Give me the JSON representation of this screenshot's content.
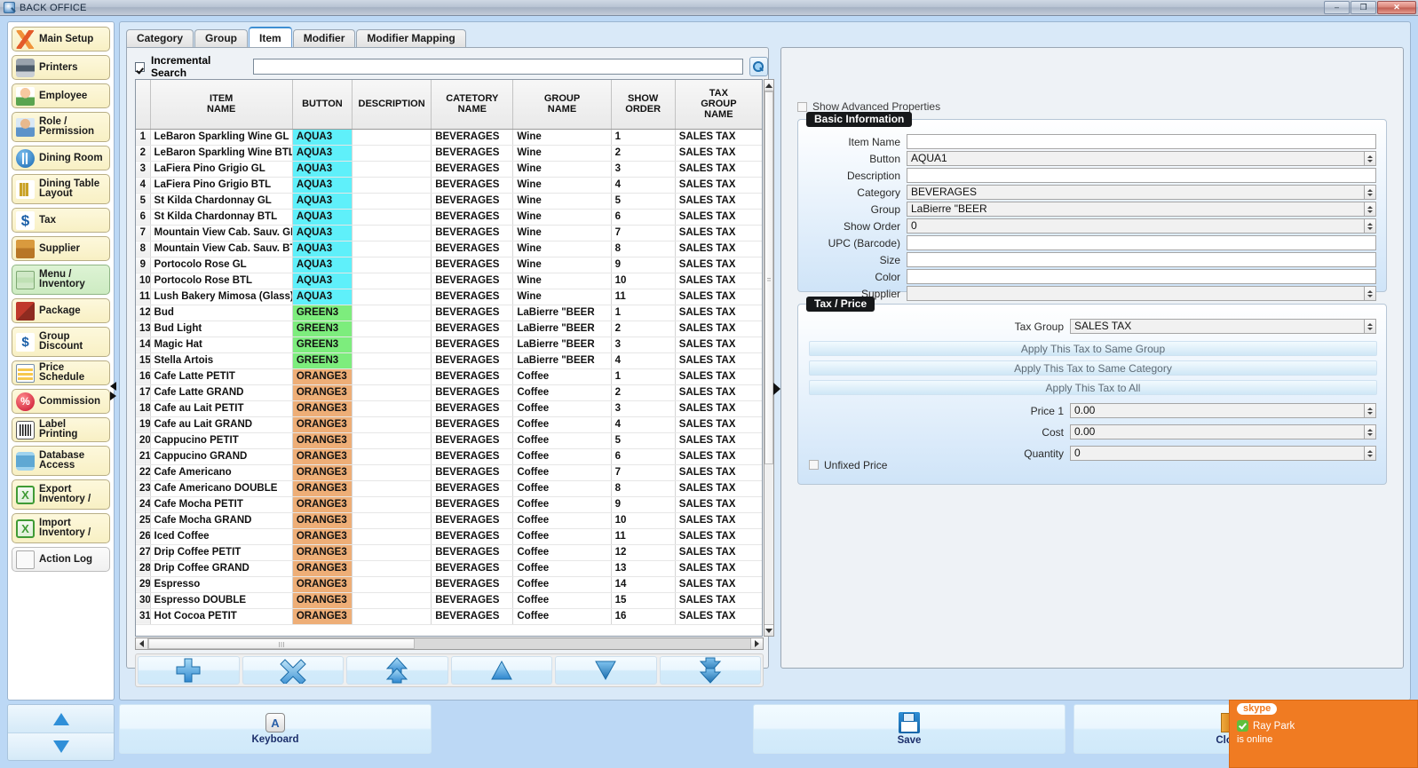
{
  "window": {
    "title": "BACK OFFICE",
    "icon": "app-search-icon",
    "controls": {
      "minimize": "–",
      "restore": "❐",
      "close": "✕"
    }
  },
  "sidebar": {
    "items": [
      {
        "label": "Main Setup",
        "icon": "tools-icon",
        "state": "normal"
      },
      {
        "label": "Printers",
        "icon": "printer-icon",
        "state": "normal"
      },
      {
        "label": "Employee",
        "icon": "employee-icon",
        "state": "normal"
      },
      {
        "label": "Role /\nPermission",
        "icon": "role-icon",
        "state": "normal"
      },
      {
        "label": "Dining Room",
        "icon": "dining-room-icon",
        "state": "normal"
      },
      {
        "label": "Dining Table\nLayout",
        "icon": "table-layout-icon",
        "state": "normal"
      },
      {
        "label": "Tax",
        "icon": "dollar-icon",
        "state": "normal"
      },
      {
        "label": "Supplier",
        "icon": "supplier-icon",
        "state": "normal"
      },
      {
        "label": "Menu /\nInventory",
        "icon": "menu-inventory-icon",
        "state": "active"
      },
      {
        "label": "Package",
        "icon": "package-icon",
        "state": "normal"
      },
      {
        "label": "Group\nDiscount",
        "icon": "group-discount-icon",
        "state": "normal"
      },
      {
        "label": "Price Schedule",
        "icon": "price-schedule-icon",
        "state": "normal"
      },
      {
        "label": "Commission",
        "icon": "percent-icon",
        "state": "normal"
      },
      {
        "label": "Label Printing",
        "icon": "barcode-icon",
        "state": "normal"
      },
      {
        "label": "Database\nAccess",
        "icon": "database-icon",
        "state": "normal"
      },
      {
        "label": "Export\nInventory /",
        "icon": "excel-export-icon",
        "state": "normal"
      },
      {
        "label": "Import\nInventory /",
        "icon": "excel-import-icon",
        "state": "normal"
      },
      {
        "label": "Action Log",
        "icon": "log-icon",
        "state": "plain"
      }
    ],
    "scroll_up": "scroll-up-arrow",
    "scroll_down": "scroll-down-arrow",
    "collapse": "collapse-handle"
  },
  "tabs": [
    {
      "label": "Category",
      "selected": false
    },
    {
      "label": "Group",
      "selected": false
    },
    {
      "label": "Item",
      "selected": true
    },
    {
      "label": "Modifier",
      "selected": false
    },
    {
      "label": "Modifier Mapping",
      "selected": false
    }
  ],
  "search": {
    "checkbox_label": "Incremental Search",
    "checked": true,
    "value": "",
    "placeholder": "",
    "button_icon": "magnifier-icon"
  },
  "table": {
    "columns": [
      "ITEM\nNAME",
      "BUTTON",
      "DESCRIPTION",
      "CATETORY\nNAME",
      "GROUP\nNAME",
      "SHOW\nORDER",
      "TAX\nGROUP\nNAME"
    ],
    "button_colors": {
      "AQUA3": "#5ff0fa",
      "GREEN3": "#7ded7d",
      "ORANGE3": "#eeae77"
    },
    "rows": [
      {
        "n": "1",
        "item": "LeBaron Sparkling Wine GL",
        "button": "AQUA3",
        "desc": "",
        "category": "BEVERAGES",
        "group": "Wine",
        "show": "1",
        "tax": "SALES TAX"
      },
      {
        "n": "2",
        "item": "LeBaron Sparkling Wine BTL",
        "button": "AQUA3",
        "desc": "",
        "category": "BEVERAGES",
        "group": "Wine",
        "show": "2",
        "tax": "SALES TAX"
      },
      {
        "n": "3",
        "item": "LaFiera Pino Grigio GL",
        "button": "AQUA3",
        "desc": "",
        "category": "BEVERAGES",
        "group": "Wine",
        "show": "3",
        "tax": "SALES TAX"
      },
      {
        "n": "4",
        "item": "LaFiera Pino Grigio BTL",
        "button": "AQUA3",
        "desc": "",
        "category": "BEVERAGES",
        "group": "Wine",
        "show": "4",
        "tax": "SALES TAX"
      },
      {
        "n": "5",
        "item": "St Kilda Chardonnay GL",
        "button": "AQUA3",
        "desc": "",
        "category": "BEVERAGES",
        "group": "Wine",
        "show": "5",
        "tax": "SALES TAX"
      },
      {
        "n": "6",
        "item": "St Kilda Chardonnay BTL",
        "button": "AQUA3",
        "desc": "",
        "category": "BEVERAGES",
        "group": "Wine",
        "show": "6",
        "tax": "SALES TAX"
      },
      {
        "n": "7",
        "item": "Mountain View Cab. Sauv. GL",
        "button": "AQUA3",
        "desc": "",
        "category": "BEVERAGES",
        "group": "Wine",
        "show": "7",
        "tax": "SALES TAX"
      },
      {
        "n": "8",
        "item": "Mountain View Cab. Sauv. BTL",
        "button": "AQUA3",
        "desc": "",
        "category": "BEVERAGES",
        "group": "Wine",
        "show": "8",
        "tax": "SALES TAX"
      },
      {
        "n": "9",
        "item": "Portocolo Rose GL",
        "button": "AQUA3",
        "desc": "",
        "category": "BEVERAGES",
        "group": "Wine",
        "show": "9",
        "tax": "SALES TAX"
      },
      {
        "n": "10",
        "item": "Portocolo Rose BTL",
        "button": "AQUA3",
        "desc": "",
        "category": "BEVERAGES",
        "group": "Wine",
        "show": "10",
        "tax": "SALES TAX"
      },
      {
        "n": "11",
        "item": "Lush Bakery Mimosa (Glass)",
        "button": "AQUA3",
        "desc": "",
        "category": "BEVERAGES",
        "group": "Wine",
        "show": "11",
        "tax": "SALES TAX"
      },
      {
        "n": "12",
        "item": "Bud",
        "button": "GREEN3",
        "desc": "",
        "category": "BEVERAGES",
        "group": "LaBierre \"BEER",
        "show": "1",
        "tax": "SALES TAX"
      },
      {
        "n": "13",
        "item": "Bud Light",
        "button": "GREEN3",
        "desc": "",
        "category": "BEVERAGES",
        "group": "LaBierre \"BEER",
        "show": "2",
        "tax": "SALES TAX"
      },
      {
        "n": "14",
        "item": "Magic Hat",
        "button": "GREEN3",
        "desc": "",
        "category": "BEVERAGES",
        "group": "LaBierre \"BEER",
        "show": "3",
        "tax": "SALES TAX"
      },
      {
        "n": "15",
        "item": "Stella Artois",
        "button": "GREEN3",
        "desc": "",
        "category": "BEVERAGES",
        "group": "LaBierre \"BEER",
        "show": "4",
        "tax": "SALES TAX"
      },
      {
        "n": "16",
        "item": "Cafe Latte PETIT",
        "button": "ORANGE3",
        "desc": "",
        "category": "BEVERAGES",
        "group": "Coffee",
        "show": "1",
        "tax": "SALES TAX"
      },
      {
        "n": "17",
        "item": "Cafe Latte GRAND",
        "button": "ORANGE3",
        "desc": "",
        "category": "BEVERAGES",
        "group": "Coffee",
        "show": "2",
        "tax": "SALES TAX"
      },
      {
        "n": "18",
        "item": "Cafe au Lait PETIT",
        "button": "ORANGE3",
        "desc": "",
        "category": "BEVERAGES",
        "group": "Coffee",
        "show": "3",
        "tax": "SALES TAX"
      },
      {
        "n": "19",
        "item": "Cafe au Lait GRAND",
        "button": "ORANGE3",
        "desc": "",
        "category": "BEVERAGES",
        "group": "Coffee",
        "show": "4",
        "tax": "SALES TAX"
      },
      {
        "n": "20",
        "item": "Cappucino PETIT",
        "button": "ORANGE3",
        "desc": "",
        "category": "BEVERAGES",
        "group": "Coffee",
        "show": "5",
        "tax": "SALES TAX"
      },
      {
        "n": "21",
        "item": "Cappucino GRAND",
        "button": "ORANGE3",
        "desc": "",
        "category": "BEVERAGES",
        "group": "Coffee",
        "show": "6",
        "tax": "SALES TAX"
      },
      {
        "n": "22",
        "item": "Cafe Americano",
        "button": "ORANGE3",
        "desc": "",
        "category": "BEVERAGES",
        "group": "Coffee",
        "show": "7",
        "tax": "SALES TAX"
      },
      {
        "n": "23",
        "item": "Cafe Americano DOUBLE",
        "button": "ORANGE3",
        "desc": "",
        "category": "BEVERAGES",
        "group": "Coffee",
        "show": "8",
        "tax": "SALES TAX"
      },
      {
        "n": "24",
        "item": "Cafe Mocha PETIT",
        "button": "ORANGE3",
        "desc": "",
        "category": "BEVERAGES",
        "group": "Coffee",
        "show": "9",
        "tax": "SALES TAX"
      },
      {
        "n": "25",
        "item": "Cafe Mocha GRAND",
        "button": "ORANGE3",
        "desc": "",
        "category": "BEVERAGES",
        "group": "Coffee",
        "show": "10",
        "tax": "SALES TAX"
      },
      {
        "n": "26",
        "item": "Iced Coffee",
        "button": "ORANGE3",
        "desc": "",
        "category": "BEVERAGES",
        "group": "Coffee",
        "show": "11",
        "tax": "SALES TAX"
      },
      {
        "n": "27",
        "item": "Drip Coffee PETIT",
        "button": "ORANGE3",
        "desc": "",
        "category": "BEVERAGES",
        "group": "Coffee",
        "show": "12",
        "tax": "SALES TAX"
      },
      {
        "n": "28",
        "item": "Drip Coffee GRAND",
        "button": "ORANGE3",
        "desc": "",
        "category": "BEVERAGES",
        "group": "Coffee",
        "show": "13",
        "tax": "SALES TAX"
      },
      {
        "n": "29",
        "item": "Espresso",
        "button": "ORANGE3",
        "desc": "",
        "category": "BEVERAGES",
        "group": "Coffee",
        "show": "14",
        "tax": "SALES TAX"
      },
      {
        "n": "30",
        "item": "Espresso DOUBLE",
        "button": "ORANGE3",
        "desc": "",
        "category": "BEVERAGES",
        "group": "Coffee",
        "show": "15",
        "tax": "SALES TAX"
      },
      {
        "n": "31",
        "item": "Hot Cocoa PETIT",
        "button": "ORANGE3",
        "desc": "",
        "category": "BEVERAGES",
        "group": "Coffee",
        "show": "16",
        "tax": "SALES TAX"
      }
    ]
  },
  "actions": [
    {
      "name": "add-item-button",
      "icon": "plus-icon"
    },
    {
      "name": "delete-item-button",
      "icon": "x-icon"
    },
    {
      "name": "move-top-button",
      "icon": "double-up-icon"
    },
    {
      "name": "move-up-button",
      "icon": "up-icon"
    },
    {
      "name": "move-down-button",
      "icon": "down-icon"
    },
    {
      "name": "move-bottom-button",
      "icon": "double-down-icon"
    }
  ],
  "detail": {
    "advanced_label": "Show Advanced Properties",
    "advanced_checked": false,
    "basic": {
      "title": "Basic Information",
      "fields": [
        {
          "label": "Item Name",
          "value": "",
          "type": "text"
        },
        {
          "label": "Button",
          "value": "AQUA1",
          "type": "spinner"
        },
        {
          "label": "Description",
          "value": "",
          "type": "text"
        },
        {
          "label": "Category",
          "value": "BEVERAGES",
          "type": "spinner"
        },
        {
          "label": "Group",
          "value": "LaBierre \"BEER",
          "type": "spinner"
        },
        {
          "label": "Show Order",
          "value": "0",
          "type": "spinner"
        },
        {
          "label": "UPC (Barcode)",
          "value": "",
          "type": "text"
        },
        {
          "label": "Size",
          "value": "",
          "type": "text"
        },
        {
          "label": "Color",
          "value": "",
          "type": "text"
        },
        {
          "label": "Supplier",
          "value": "",
          "type": "spinner"
        }
      ]
    },
    "tax": {
      "title": "Tax / Price",
      "tax_group_label": "Tax Group",
      "tax_group_value": "SALES TAX",
      "apply_buttons": [
        "Apply This Tax to Same Group",
        "Apply This Tax to Same Category",
        "Apply This Tax to All"
      ],
      "fields": [
        {
          "label": "Price 1",
          "value": "0.00"
        },
        {
          "label": "Cost",
          "value": "0.00"
        },
        {
          "label": "Quantity",
          "value": "0"
        }
      ],
      "unfixed_label": "Unfixed Price",
      "unfixed_checked": false
    }
  },
  "footer": {
    "keyboard": {
      "label": "Keyboard",
      "icon": "keyboard-icon",
      "key": "A"
    },
    "save": {
      "label": "Save",
      "icon": "floppy-icon"
    },
    "close": {
      "label": "Close",
      "icon": "exit-door-icon"
    }
  },
  "skype_toast": {
    "logo": "skype",
    "name": "Ray Park",
    "status": "is online"
  }
}
